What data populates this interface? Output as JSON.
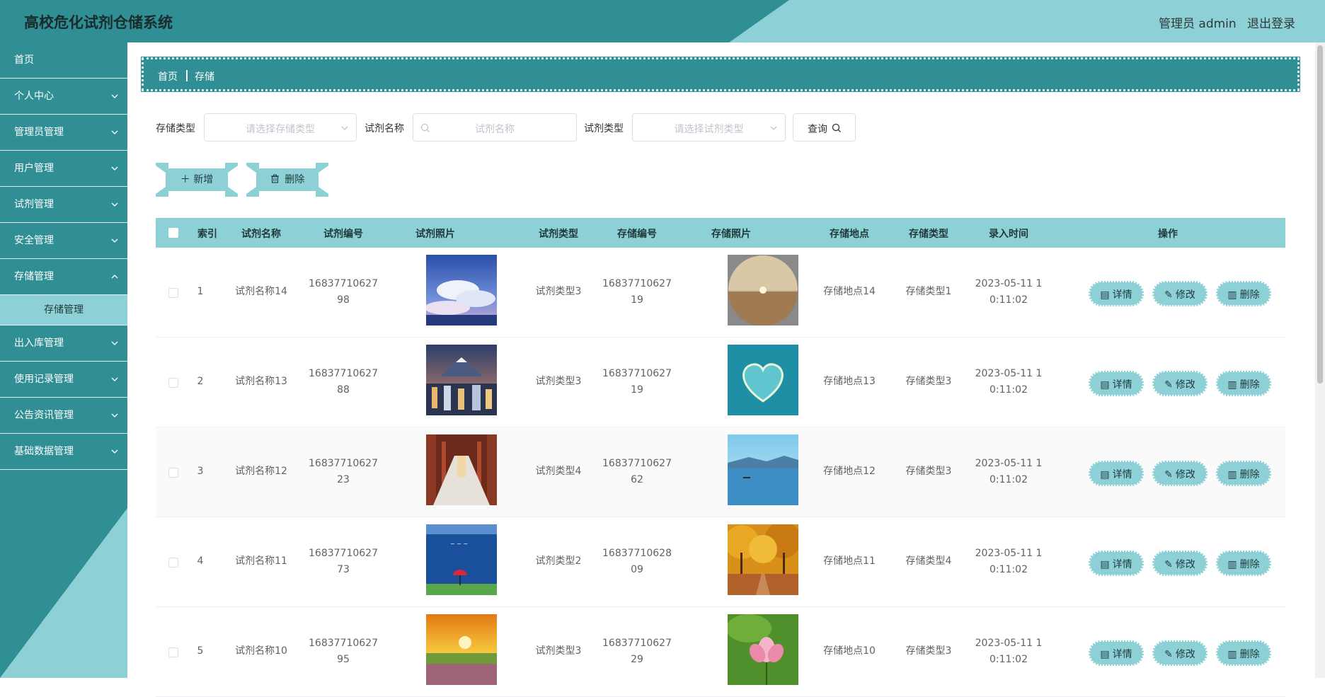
{
  "app": {
    "title": "高校危化试剂仓储系统",
    "user": "管理员 admin",
    "logout": "退出登录"
  },
  "colors": {
    "primary": "#2f8f95",
    "accent": "#8dd0d6"
  },
  "sidebar": {
    "items": [
      {
        "label": "首页"
      },
      {
        "label": "个人中心"
      },
      {
        "label": "管理员管理"
      },
      {
        "label": "用户管理"
      },
      {
        "label": "试剂管理"
      },
      {
        "label": "安全管理"
      },
      {
        "label": "存储管理"
      },
      {
        "label": "出入库管理"
      },
      {
        "label": "使用记录管理"
      },
      {
        "label": "公告资讯管理"
      },
      {
        "label": "基础数据管理"
      }
    ],
    "sub_item": "存储管理"
  },
  "breadcrumb": {
    "home": "首页",
    "current": "存储"
  },
  "search": {
    "storage_type_label": "存储类型",
    "storage_type_placeholder": "请选择存储类型",
    "name_label": "试剂名称",
    "name_placeholder": "试剂名称",
    "reagent_type_label": "试剂类型",
    "reagent_type_placeholder": "请选择试剂类型",
    "query_label": "查询"
  },
  "actions": {
    "add_label": "新增",
    "delete_label": "删除"
  },
  "table": {
    "headers": [
      "索引",
      "试剂名称",
      "试剂编号",
      "试剂照片",
      "试剂类型",
      "存储编号",
      "存储照片",
      "存储地点",
      "存储类型",
      "录入时间",
      "操作"
    ],
    "row_buttons": {
      "detail": "详情",
      "edit": "修改",
      "delete": "删除"
    },
    "rows": [
      {
        "index": "1",
        "name": "试剂名称14",
        "code_a": "16837710627",
        "code_b": "98",
        "type": "试剂类型3",
        "scode_a": "16837710627",
        "scode_b": "19",
        "location": "存储地点14",
        "stype": "存储类型1",
        "time_a": "2023-05-11 1",
        "time_b": "0:11:02",
        "photo1": "sky-clouds-image",
        "photo2": "desert-sunset-image"
      },
      {
        "index": "2",
        "name": "试剂名称13",
        "code_a": "16837710627",
        "code_b": "88",
        "type": "试剂类型3",
        "scode_a": "16837710627",
        "scode_b": "19",
        "location": "存储地点13",
        "stype": "存储类型3",
        "time_a": "2023-05-11 1",
        "time_b": "0:11:02",
        "photo1": "mountain-city-image",
        "photo2": "heart-island-image"
      },
      {
        "index": "3",
        "name": "试剂名称12",
        "code_a": "16837710627",
        "code_b": "23",
        "type": "试剂类型4",
        "scode_a": "16837710627",
        "scode_b": "62",
        "location": "存储地点12",
        "stype": "存储类型3",
        "time_a": "2023-05-11 1",
        "time_b": "0:11:02",
        "photo1": "corridor-image",
        "photo2": "blue-lake-image"
      },
      {
        "index": "4",
        "name": "试剂名称11",
        "code_a": "16837710627",
        "code_b": "73",
        "type": "试剂类型2",
        "scode_a": "16837710628",
        "scode_b": "09",
        "location": "存储地点11",
        "stype": "存储类型4",
        "time_a": "2023-05-11 1",
        "time_b": "0:11:02",
        "photo1": "sea-umbrella-image",
        "photo2": "autumn-trees-image"
      },
      {
        "index": "5",
        "name": "试剂名称10",
        "code_a": "16837710627",
        "code_b": "95",
        "type": "试剂类型3",
        "scode_a": "16837710627",
        "scode_b": "29",
        "location": "存储地点10",
        "stype": "存储类型3",
        "time_a": "2023-05-11 1",
        "time_b": "0:11:02",
        "photo1": "sunset-field-image",
        "photo2": "lotus-image"
      }
    ]
  }
}
